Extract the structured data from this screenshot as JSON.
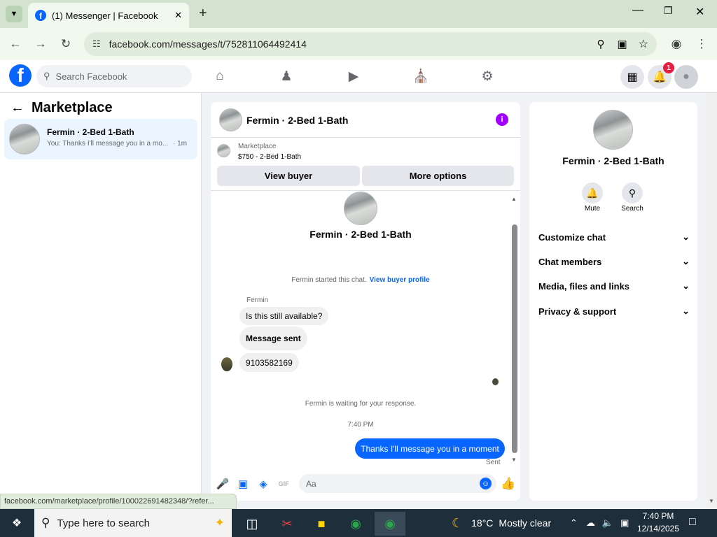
{
  "browser": {
    "tab_title": "(1) Messenger | Facebook",
    "url": "facebook.com/messages/t/752811064492414",
    "status_url": "facebook.com/marketplace/profile/100022691482348/?refer..."
  },
  "fb": {
    "search_placeholder": "Search Facebook",
    "notification_count": "1"
  },
  "left": {
    "title": "Marketplace",
    "conversation": {
      "name": "Fermin · 2-Bed 1-Bath",
      "preview": "You: Thanks I'll message you in a mo...",
      "time": "· 1m"
    }
  },
  "chat": {
    "title": "Fermin · 2-Bed 1-Bath",
    "listing_source": "Marketplace",
    "listing_price_title": "$750 - 2-Bed 1-Bath",
    "view_buyer": "View buyer",
    "more_options": "More options",
    "profile_name": "Fermin · 2-Bed 1-Bath",
    "started_text": "Fermin started this chat.",
    "view_buyer_profile": "View buyer profile",
    "sender_name": "Fermin",
    "messages": [
      "Is this still available?",
      "Message sent",
      "9103582169"
    ],
    "waiting_text": "Fermin is waiting for your response.",
    "time_divider": "7:40 PM",
    "my_message": "Thanks I'll message you in a moment",
    "sent_status": "Sent",
    "input_placeholder": "Aa",
    "gif_label": "GIF"
  },
  "right": {
    "name": "Fermin · 2-Bed 1-Bath",
    "mute": "Mute",
    "search": "Search",
    "sections": [
      "Customize chat",
      "Chat members",
      "Media, files and links",
      "Privacy & support"
    ]
  },
  "taskbar": {
    "search_placeholder": "Type here to search",
    "temperature": "18°C",
    "weather": "Mostly clear",
    "time": "7:40 PM",
    "date": "12/14/2025"
  }
}
